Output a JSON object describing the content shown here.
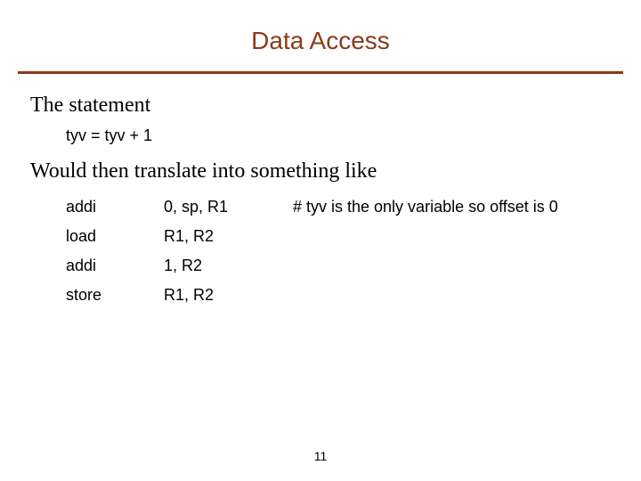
{
  "title": "Data Access",
  "line1": "The statement",
  "stmt": "tyv = tyv + 1",
  "line2": "Would then translate into something like",
  "asm": [
    {
      "op": "addi",
      "args": "0, sp, R1",
      "comment": "# tyv is the only variable so offset is 0"
    },
    {
      "op": "load",
      "args": "R1, R2",
      "comment": ""
    },
    {
      "op": "addi",
      "args": "1, R2",
      "comment": ""
    },
    {
      "op": "store",
      "args": "R1, R2",
      "comment": ""
    }
  ],
  "page_number": "11"
}
